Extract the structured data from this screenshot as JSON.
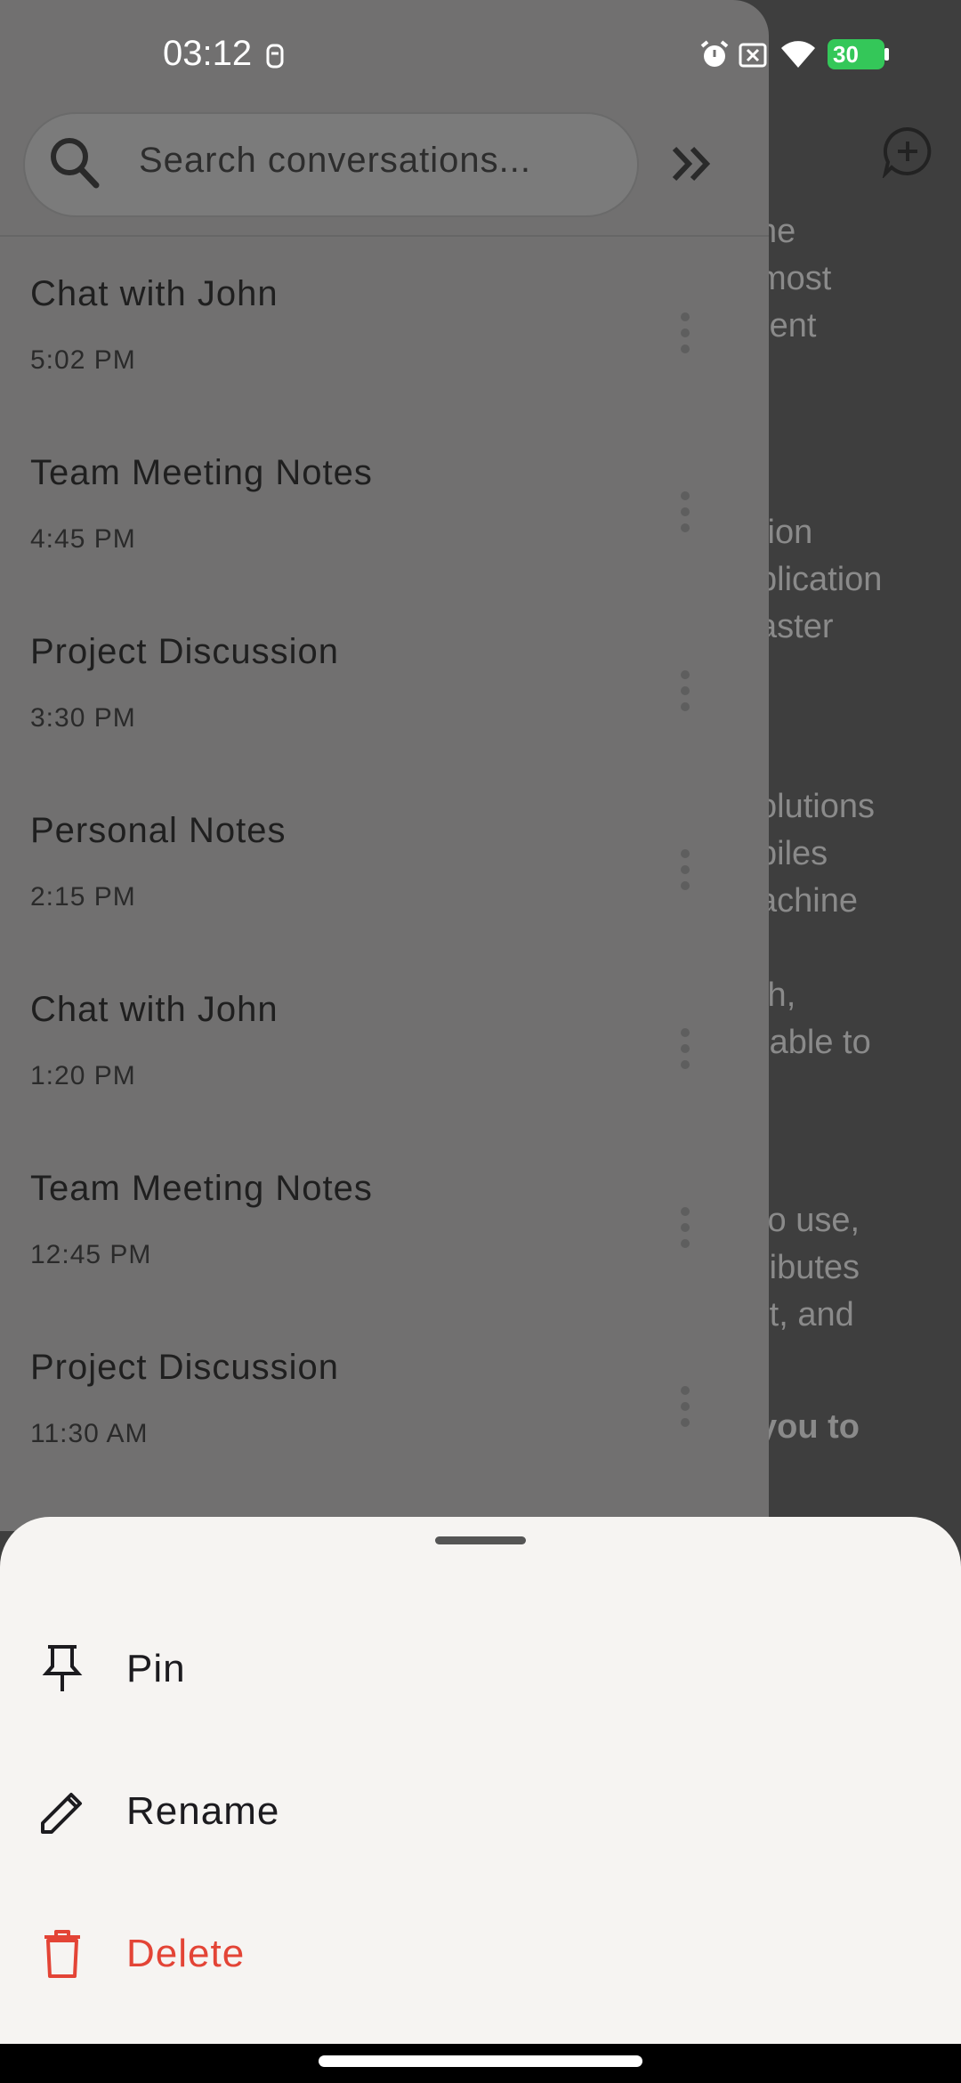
{
  "status_bar": {
    "time": "03:12",
    "battery": "30"
  },
  "background_page": {
    "text_lines": [
      {
        "text": "he"
      },
      {
        "text": "most"
      },
      {
        "text": "rent"
      },
      {
        "text": "tion"
      },
      {
        "text": "plication"
      },
      {
        "text": "aster"
      },
      {
        "text": "olutions"
      },
      {
        "text": "piles"
      },
      {
        "text": "achine"
      },
      {
        "text": "th,"
      },
      {
        "text": "rable to"
      },
      {
        "text": "to use,"
      },
      {
        "text": "ributes"
      },
      {
        "text": "rt, and"
      },
      {
        "text": "you to"
      }
    ]
  },
  "drawer": {
    "search": {
      "placeholder": "Search conversations..."
    },
    "conversations": [
      {
        "title": "Chat with John",
        "time": "5:02 PM"
      },
      {
        "title": "Team Meeting Notes",
        "time": "4:45 PM"
      },
      {
        "title": "Project Discussion",
        "time": "3:30 PM"
      },
      {
        "title": "Personal Notes",
        "time": "2:15 PM"
      },
      {
        "title": "Chat with John",
        "time": "1:20 PM"
      },
      {
        "title": "Team Meeting Notes",
        "time": "12:45 PM"
      },
      {
        "title": "Project Discussion",
        "time": "11:30 AM"
      }
    ]
  },
  "bottom_sheet": {
    "pin_label": "Pin",
    "rename_label": "Rename",
    "delete_label": "Delete"
  },
  "colors": {
    "danger": "#e34436",
    "battery_green": "#34c759"
  }
}
